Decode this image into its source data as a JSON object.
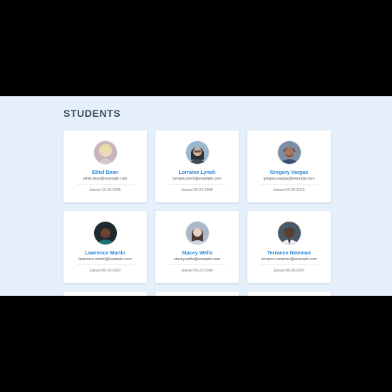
{
  "page": {
    "title": "STUDENTS",
    "background": "#e6f0fb",
    "accent": "#2a86d4"
  },
  "students": [
    {
      "name": "Ethel Dean",
      "email": "ethel.dean@example.com",
      "joined": "Joined 12-15-2005"
    },
    {
      "name": "Lorraine Lynch",
      "email": "lorraine.lynch@example.com",
      "joined": "Joined 02-24-2006"
    },
    {
      "name": "Gregory Vargas",
      "email": "gregory.vargas@example.com",
      "joined": "Joined 03-20-2013"
    },
    {
      "name": "Lawrence Martin",
      "email": "lawrence.martin@example.com",
      "joined": "Joined 06-10-2007"
    },
    {
      "name": "Stacey Wells",
      "email": "stacey.wells@example.com",
      "joined": "Joined 09-22-2004"
    },
    {
      "name": "Terrance Newman",
      "email": "terrance.newman@example.com",
      "joined": "Joined 06-28-2007"
    }
  ]
}
